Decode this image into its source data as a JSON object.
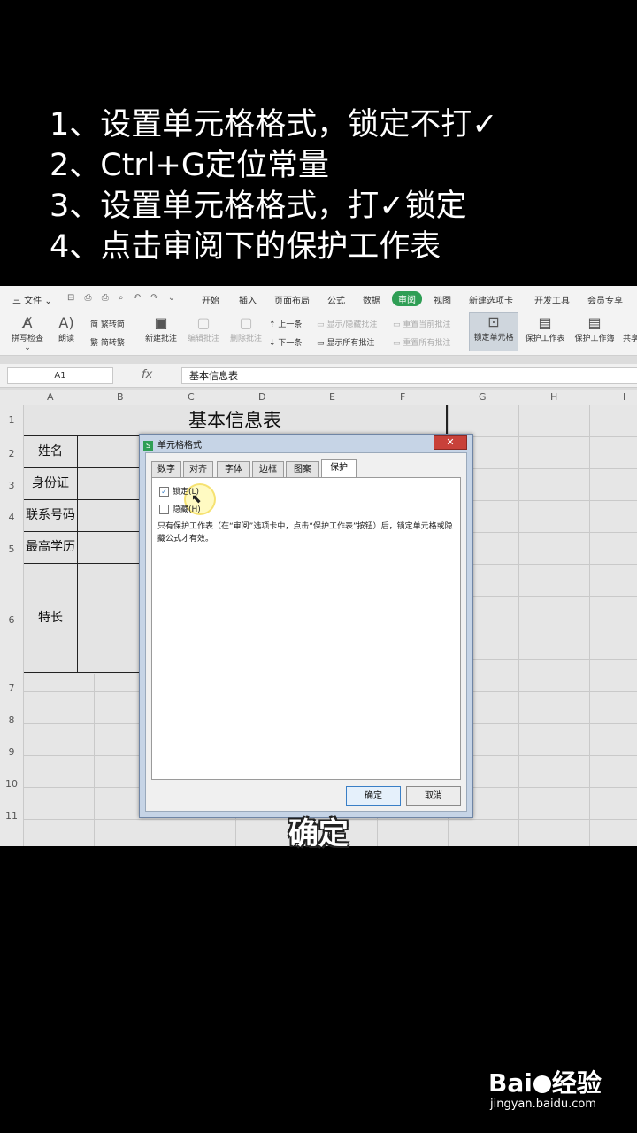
{
  "steps": [
    "1、设置单元格格式，锁定不打✓",
    "2、Ctrl+G定位常量",
    "3、设置单元格格式，打✓锁定",
    "4、点击审阅下的保护工作表"
  ],
  "menubar": {
    "file": "三 文件 ⌄",
    "quick_access": "⊟ ⎙ ⎙ ⌕ ↶ ↷ ⌄",
    "tabs": [
      "开始",
      "插入",
      "页面布局",
      "公式",
      "数据",
      "审阅",
      "视图",
      "新建选项卡",
      "开发工具",
      "会员专享"
    ],
    "active_tab": "审阅"
  },
  "ribbon": {
    "spell_check": "拼写检查 ⌄",
    "read_aloud": "朗读",
    "trad_to_simp": "繁转简",
    "simp_to_trad": "简转繁",
    "new_comment": "新建批注",
    "edit_comment": "编辑批注",
    "delete_comment": "删除批注",
    "prev": "上一条",
    "next": "下一条",
    "show_hide_comment": "显示/隐藏批注",
    "show_all_comments": "显示所有批注",
    "reset_current": "重置当前批注",
    "reset_all": "重置所有批注",
    "lock_cell": "锁定单元格",
    "protect_sheet": "保护工作表",
    "protect_workbook": "保护工作簿",
    "share": "共享"
  },
  "formula_bar": {
    "name_box": "A1",
    "fx": "fx",
    "content": "基本信息表"
  },
  "columns": [
    "A",
    "B",
    "C",
    "D",
    "E",
    "F",
    "G",
    "H",
    "I"
  ],
  "rows": [
    "1",
    "2",
    "3",
    "4",
    "5",
    "6",
    "7",
    "8",
    "9",
    "10",
    "11"
  ],
  "sheet_form": {
    "title": "基本信息表",
    "labels": [
      "姓名",
      "身份证",
      "联系号码",
      "最高学历",
      "特长"
    ]
  },
  "dialog": {
    "title": "单元格格式",
    "close": "✕",
    "tabs": [
      "数字",
      "对齐",
      "字体",
      "边框",
      "图案",
      "保护"
    ],
    "active_tab": "保护",
    "locked_label": "锁定(L)",
    "locked_checked": true,
    "hidden_label": "隐藏(H)",
    "hidden_checked": false,
    "note": "只有保护工作表（在“审阅”选项卡中，点击“保护工作表”按钮）后，锁定单元格或隐藏公式才有效。",
    "ok": "确定",
    "cancel": "取消"
  },
  "subtitle": "确定",
  "watermark": {
    "brand_left": "Bai",
    "brand_right": "经验",
    "url": "jingyan.baidu.com"
  }
}
